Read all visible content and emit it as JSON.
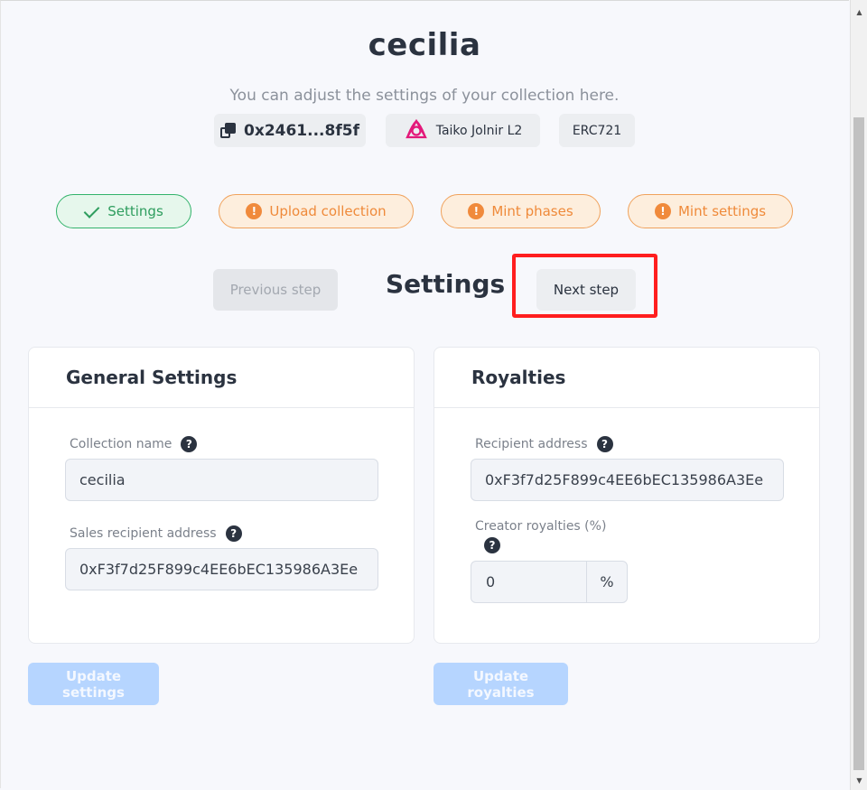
{
  "header": {
    "title": "cecilia",
    "subtitle": "You can adjust the settings of your collection here."
  },
  "meta": {
    "address": "0x2461...8f5f",
    "chain": "Taiko Jolnir L2",
    "standard": "ERC721"
  },
  "steps": [
    {
      "label": "Settings",
      "status": "done"
    },
    {
      "label": "Upload collection",
      "status": "warning"
    },
    {
      "label": "Mint phases",
      "status": "warning"
    },
    {
      "label": "Mint settings",
      "status": "warning"
    }
  ],
  "nav": {
    "previous_label": "Previous step",
    "current_title": "Settings",
    "next_label": "Next step"
  },
  "general": {
    "title": "General Settings",
    "collection_name_label": "Collection name",
    "collection_name_value": "cecilia",
    "sales_recipient_label": "Sales recipient address",
    "sales_recipient_value": "0xF3f7d25F899c4EE6bEC135986A3Ee"
  },
  "royalties": {
    "title": "Royalties",
    "recipient_label": "Recipient address",
    "recipient_value": "0xF3f7d25F899c4EE6bEC135986A3Ee",
    "creator_label": "Creator royalties (%)",
    "creator_value": "0",
    "percent_sign": "%"
  },
  "actions": {
    "update_settings": "Update settings",
    "update_royalties": "Update royalties"
  },
  "icons": {
    "help": "?",
    "warning": "!"
  },
  "colors": {
    "success": "#33b36b",
    "warning": "#f08a3c",
    "highlight": "#ff1e1e",
    "primary_disabled": "#b6d5ff"
  }
}
